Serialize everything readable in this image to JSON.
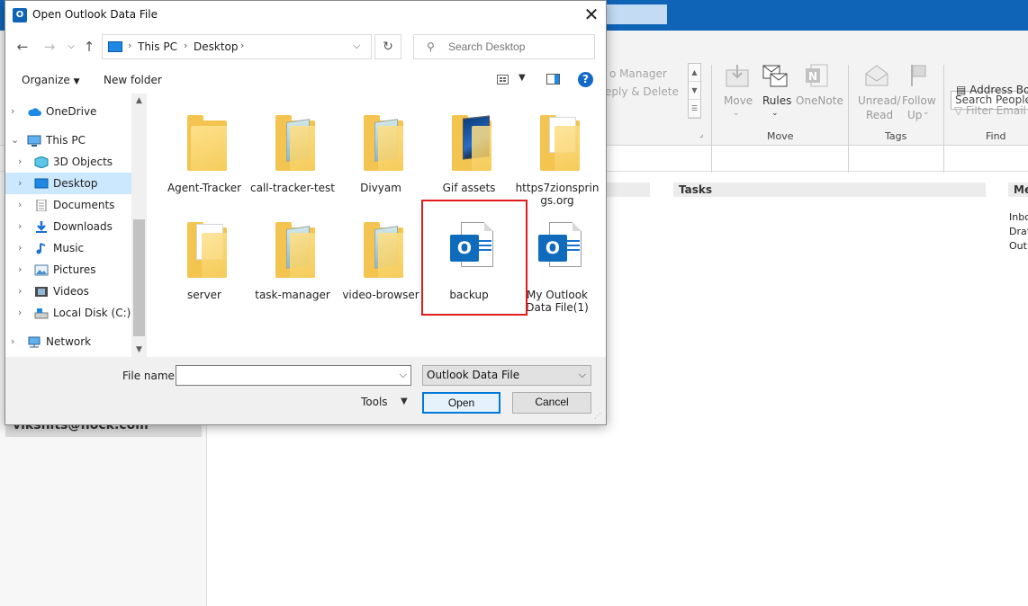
{
  "outlook": {
    "ribbon": {
      "quick_step_1": "o Manager",
      "quick_step_2": "eply & Delete",
      "move_label": "Move",
      "rules_label": "Rules",
      "onenote_label": "OneNote",
      "unread_read_label_1": "Unread/",
      "unread_read_label_2": "Read",
      "follow_up_label_1": "Follow",
      "follow_up_label_2": "Up",
      "group_move": "Move",
      "group_tags": "Tags",
      "group_find": "Find",
      "search_people": "Search People",
      "address_book": "Address Boo",
      "filter_email": "Filter Email"
    },
    "panel_tasks": "Tasks",
    "panel_me": "Me",
    "folders": [
      "Inbo",
      "Draf",
      "Outb"
    ],
    "account": "vikshits@flock.com"
  },
  "dialog": {
    "title": "Open Outlook Data File",
    "close_glyph": "✕",
    "nav": {
      "back": "←",
      "forward": "→",
      "recent": "⌵",
      "up": "↑",
      "refresh": "↻",
      "search_placeholder": "Search Desktop",
      "search_glyph": "⚲"
    },
    "address": {
      "crumbs": [
        "This PC",
        "Desktop"
      ],
      "sep": "›"
    },
    "commands": {
      "organize": "Organize",
      "new_folder": "New folder",
      "help": "?"
    },
    "nav_pane": {
      "items": [
        {
          "label": "OneDrive",
          "icon": "cloud-icon"
        },
        {
          "label": "This PC",
          "icon": "computer-icon"
        },
        {
          "label": "3D Objects",
          "icon": "cube-icon"
        },
        {
          "label": "Desktop",
          "icon": "desktop-icon"
        },
        {
          "label": "Documents",
          "icon": "documents-icon"
        },
        {
          "label": "Downloads",
          "icon": "download-icon"
        },
        {
          "label": "Music",
          "icon": "music-icon"
        },
        {
          "label": "Pictures",
          "icon": "pictures-icon"
        },
        {
          "label": "Videos",
          "icon": "videos-icon"
        },
        {
          "label": "Local Disk (C:)",
          "icon": "disk-icon"
        },
        {
          "label": "Network",
          "icon": "network-icon"
        }
      ]
    },
    "files": [
      {
        "label": "Agent-Tracker",
        "type": "folder"
      },
      {
        "label": "call-tracker-test",
        "type": "folder"
      },
      {
        "label": "Divyam",
        "type": "folder"
      },
      {
        "label": "Gif assets",
        "type": "folder"
      },
      {
        "label": "https7zionsprings.org",
        "type": "folder"
      },
      {
        "label": "server",
        "type": "folder"
      },
      {
        "label": "task-manager",
        "type": "folder"
      },
      {
        "label": "video-browser",
        "type": "folder"
      },
      {
        "label": "backup",
        "type": "outlook-data-file"
      },
      {
        "label": "My Outlook Data File(1)",
        "type": "outlook-data-file"
      }
    ],
    "bottom": {
      "file_name_label": "File name:",
      "file_name_value": "",
      "file_type": "Outlook Data File",
      "tools": "Tools",
      "open": "Open",
      "cancel": "Cancel"
    },
    "colors": {
      "accent": "#0078d7",
      "highlight_box": "#e21b1b",
      "outlook_blue": "#0f64b8"
    }
  }
}
